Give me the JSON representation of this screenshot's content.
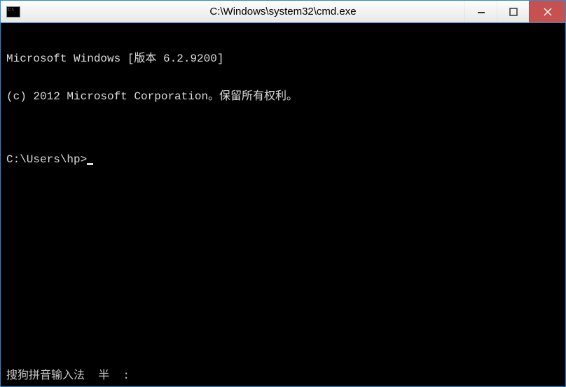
{
  "window": {
    "title": "C:\\Windows\\system32\\cmd.exe"
  },
  "terminal": {
    "line1": "Microsoft Windows [版本 6.2.9200]",
    "line2": "(c) 2012 Microsoft Corporation。保留所有权利。",
    "blank": "",
    "prompt": "C:\\Users\\hp>"
  },
  "ime": {
    "status": "搜狗拼音输入法  半  :"
  }
}
